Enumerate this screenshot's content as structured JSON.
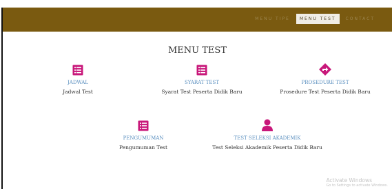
{
  "nav": {
    "items": [
      {
        "label": "MENU TIPE"
      },
      {
        "label": "MENU TEST",
        "active": true
      },
      {
        "label": "CONTACT"
      }
    ]
  },
  "page": {
    "title": "MENU TEST"
  },
  "cards": [
    {
      "title": "JADWAL",
      "desc": "Jadwal Test",
      "icon": "list-icon"
    },
    {
      "title": "SYARAT TEST",
      "desc": "Syarat Test Peserta Didik Baru",
      "icon": "list-icon"
    },
    {
      "title": "PROSEDURE TEST",
      "desc": "Prosedure Test Peserta Didik Baru",
      "icon": "directions-icon"
    },
    {
      "title": "PENGUMUMAN",
      "desc": "Pengumuman Test",
      "icon": "list-icon"
    },
    {
      "title": "TEST SELEKSI AKADEMIK",
      "desc": "Test Seleksi Akademik Peserta Didik Baru",
      "icon": "user-icon"
    }
  ],
  "watermark": {
    "title": "Activate Windows",
    "subtitle": "Go to Settings to activate Windows."
  },
  "colors": {
    "header": "#7a5a10",
    "accent": "#c8177a",
    "link": "#5a8fbf"
  }
}
